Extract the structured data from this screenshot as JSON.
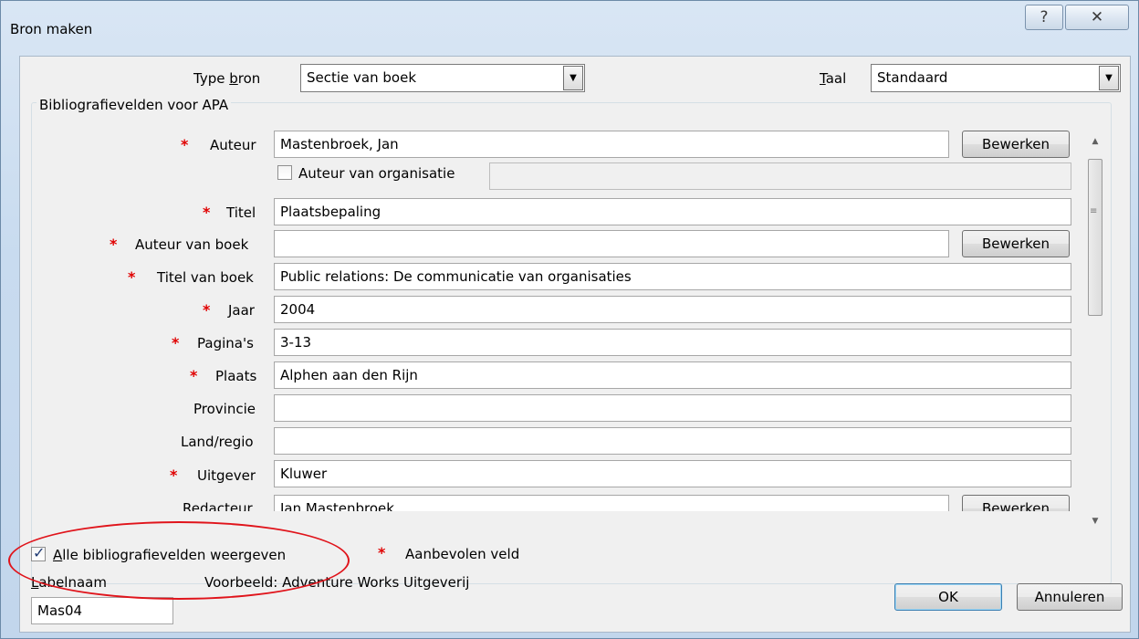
{
  "window": {
    "title": "Bron maken",
    "help_label": "?",
    "close_label": "✕"
  },
  "source_type": {
    "label_pre": "Type ",
    "label_key": "b",
    "label_post": "ron",
    "value": "Sectie van boek"
  },
  "language": {
    "label_key": "T",
    "label_post": "aal",
    "value": "Standaard"
  },
  "group_title": "Bibliografievelden voor APA",
  "fields": {
    "author": {
      "label": "Auteur",
      "value": "Mastenbroek, Jan",
      "button": "Bewerken"
    },
    "corporate_author": {
      "label": "Auteur van organisatie",
      "checked": false,
      "value": ""
    },
    "title": {
      "label": "Titel",
      "value": "Plaatsbepaling"
    },
    "book_author": {
      "label": "Auteur van boek",
      "value": "",
      "button": "Bewerken"
    },
    "book_title": {
      "label": "Titel van boek",
      "value": "Public relations: De communicatie van organisaties"
    },
    "year": {
      "label": "Jaar",
      "value": "2004"
    },
    "pages": {
      "label": "Pagina's",
      "value": "3-13"
    },
    "city": {
      "label": "Plaats",
      "value": "Alphen aan den Rijn"
    },
    "state": {
      "label": "Provincie",
      "value": ""
    },
    "country": {
      "label": "Land/regio",
      "value": ""
    },
    "publisher": {
      "label": "Uitgever",
      "value": "Kluwer"
    },
    "editor": {
      "label": "Redacteur",
      "value": "Jan Mastenbroek",
      "button": "Bewerken"
    }
  },
  "show_all": {
    "label_key": "A",
    "label_post": "lle bibliografievelden weergeven",
    "checked": true
  },
  "recommended_legend": "Aanbevolen veld",
  "tag": {
    "label_key": "L",
    "label_post": "abelnaam",
    "value": "Mas04"
  },
  "example": "Voorbeeld: Adventure Works Uitgeverij",
  "buttons": {
    "ok": "OK",
    "cancel": "Annuleren"
  },
  "colors": {
    "required_star": "#e00000",
    "annotation": "#e0141b"
  }
}
